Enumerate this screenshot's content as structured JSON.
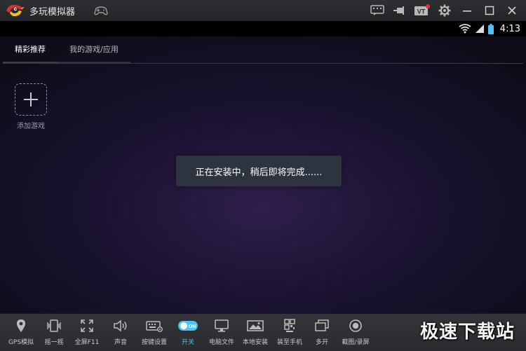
{
  "window": {
    "title": "多玩模拟器"
  },
  "statusbar": {
    "time": "4:13"
  },
  "tabs": [
    {
      "label": "精彩推荐",
      "active": true
    },
    {
      "label": "我的游戏/应用",
      "active": false
    }
  ],
  "add_game": {
    "label": "添加游戏"
  },
  "toast": {
    "message": "正在安装中，稍后即将完成......"
  },
  "toolbar": {
    "items": [
      {
        "label": "GPS模拟",
        "icon": "location-pin-icon"
      },
      {
        "label": "摇一摇",
        "icon": "shake-icon"
      },
      {
        "label": "全屏F11",
        "icon": "fullscreen-icon"
      },
      {
        "label": "声音",
        "icon": "speaker-icon"
      },
      {
        "label": "按键设置",
        "icon": "keyboard-settings-icon"
      },
      {
        "label": "开关",
        "icon": "toggle-on-icon",
        "toggle_text": "ON"
      },
      {
        "label": "电脑文件",
        "icon": "monitor-icon"
      },
      {
        "label": "本地安装",
        "icon": "image-install-icon"
      },
      {
        "label": "装至手机",
        "icon": "qr-phone-icon"
      },
      {
        "label": "多开",
        "icon": "multi-window-icon"
      },
      {
        "label": "截图/录屏",
        "icon": "record-icon"
      }
    ]
  },
  "watermark": {
    "text": "极速下载站"
  },
  "colors": {
    "accent": "#4ec3f0",
    "notification_dot": "#e8343c"
  }
}
